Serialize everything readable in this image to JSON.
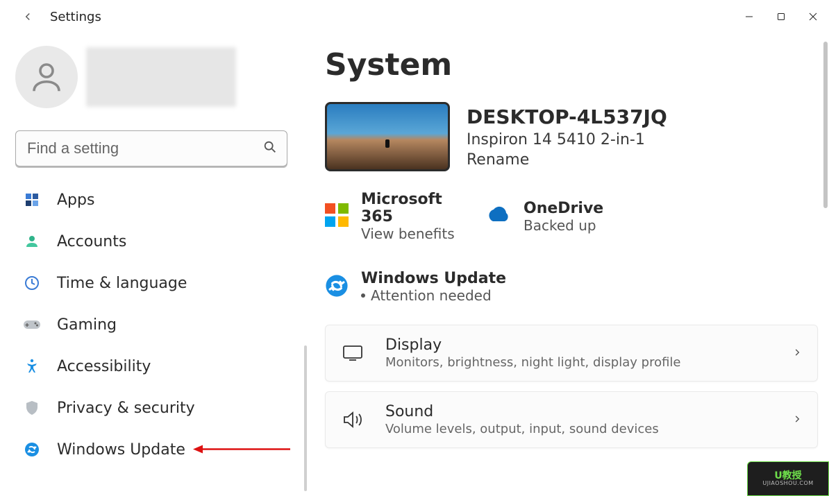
{
  "window": {
    "title": "Settings"
  },
  "search": {
    "placeholder": "Find a setting"
  },
  "sidebar": {
    "items": [
      {
        "label": "Apps"
      },
      {
        "label": "Accounts"
      },
      {
        "label": "Time & language"
      },
      {
        "label": "Gaming"
      },
      {
        "label": "Accessibility"
      },
      {
        "label": "Privacy & security"
      },
      {
        "label": "Windows Update"
      }
    ]
  },
  "main": {
    "title": "System",
    "device": {
      "name": "DESKTOP-4L537JQ",
      "model": "Inspiron 14 5410 2-in-1",
      "rename": "Rename"
    },
    "status": {
      "m365": {
        "title": "Microsoft 365",
        "sub": "View benefits"
      },
      "onedrive": {
        "title": "OneDrive",
        "sub": "Backed up"
      },
      "winupdate": {
        "title": "Windows Update",
        "sub": "Attention needed"
      }
    },
    "cards": [
      {
        "title": "Display",
        "sub": "Monitors, brightness, night light, display profile"
      },
      {
        "title": "Sound",
        "sub": "Volume levels, output, input, sound devices"
      }
    ]
  },
  "watermark": {
    "big": "U教授",
    "small": "UJIAOSHOU.COM"
  }
}
